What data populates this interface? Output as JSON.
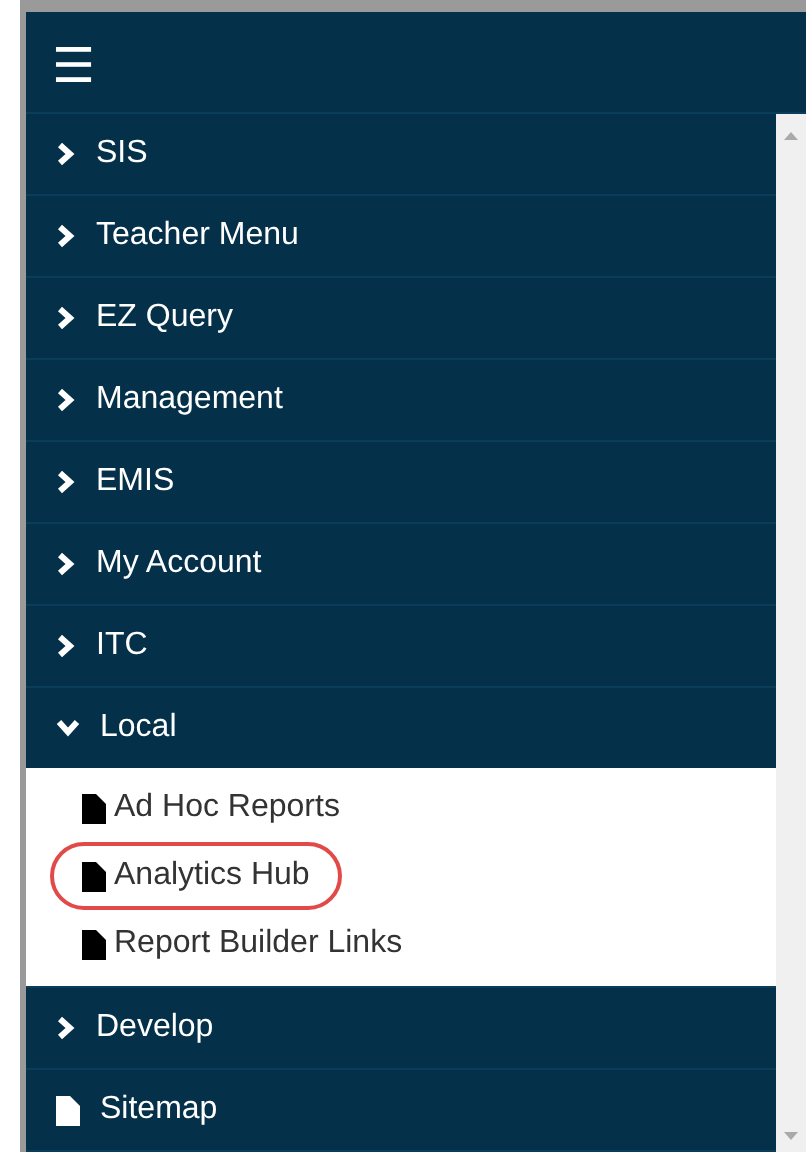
{
  "menu_button": {
    "icon": "☰"
  },
  "nav": [
    {
      "kind": "folder",
      "label": "SIS",
      "expanded": false
    },
    {
      "kind": "folder",
      "label": "Teacher Menu",
      "expanded": false
    },
    {
      "kind": "folder",
      "label": "EZ Query",
      "expanded": false
    },
    {
      "kind": "folder",
      "label": "Management",
      "expanded": false
    },
    {
      "kind": "folder",
      "label": "EMIS",
      "expanded": false
    },
    {
      "kind": "folder",
      "label": "My Account",
      "expanded": false
    },
    {
      "kind": "folder",
      "label": "ITC",
      "expanded": false
    },
    {
      "kind": "folder",
      "label": "Local",
      "expanded": true,
      "children": [
        {
          "label": "Ad Hoc Reports",
          "highlighted": false
        },
        {
          "label": "Analytics Hub",
          "highlighted": true
        },
        {
          "label": "Report Builder Links",
          "highlighted": false
        }
      ]
    },
    {
      "kind": "folder",
      "label": "Develop",
      "expanded": false
    },
    {
      "kind": "page",
      "label": "Sitemap"
    }
  ]
}
